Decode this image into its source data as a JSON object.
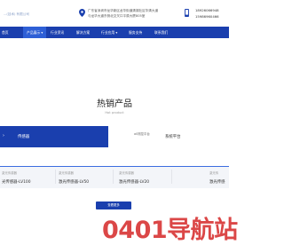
{
  "header": {
    "company": "...(技术) 有限公司",
    "address_line1": "广东省深圳市龙华新区龙华街道清湖社区华清大道",
    "address_line2": "与龙华大道东侧北交叉口平原大厦805室",
    "phone1": "18926066948",
    "phone2": "15986960466",
    "colors": {
      "brand": "#1a3fae",
      "accent": "#2e5fd6"
    }
  },
  "nav": {
    "items": [
      {
        "label": "首页"
      },
      {
        "label": "产品展示"
      },
      {
        "label": "行业资讯"
      },
      {
        "label": "解决方案"
      },
      {
        "label": "行业应用"
      },
      {
        "label": "服务支持"
      },
      {
        "label": "联系我们"
      }
    ]
  },
  "section": {
    "title": "热销产品",
    "subtitle": "Hot product"
  },
  "categories": {
    "active": "传感器",
    "tag": "a0测控平台",
    "right": "系统平台"
  },
  "products": [
    {
      "img_alt": "激光传感器",
      "name": "光传感器-LV100"
    },
    {
      "img_alt": "激光传感器",
      "name": "激光传感器-LV50"
    },
    {
      "img_alt": "激光传感器",
      "name": "激光传感器-LV20"
    },
    {
      "img_alt": "激光传",
      "name": "激光传感"
    }
  ],
  "more_button": "查看更多",
  "watermark": "0401导航站"
}
